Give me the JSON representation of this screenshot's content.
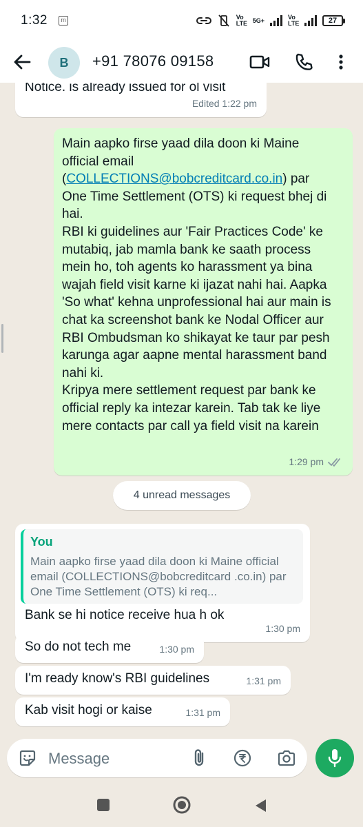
{
  "status_bar": {
    "time": "1:32",
    "net_type": "5G+",
    "volte1": "Vo LTE",
    "volte2": "Vo LTE",
    "battery": "27"
  },
  "header": {
    "avatar_letter": "B",
    "contact": "+91 78076 09158",
    "icons": [
      "back-arrow-icon",
      "video-call-icon",
      "voice-call-icon",
      "more-options-icon"
    ]
  },
  "messages": [
    {
      "id": "m0",
      "direction": "incoming",
      "text": "Notice. is already issued for ol visit",
      "time": "Edited 1:22 pm"
    },
    {
      "id": "m1",
      "direction": "outgoing",
      "text_before_link": "Main aapko firse yaad dila doon ki Maine official email (",
      "link": "COLLECTIONS@bobcreditcard.co.in",
      "text_after_link": ") par One Time Settlement (OTS) ki request bhej di hai.",
      "paragraph2": "RBI ki guidelines aur 'Fair Practices Code' ke mutabiq, jab mamla bank ke saath process mein ho, toh agents ko harassment ya bina wajah field visit karne ki ijazat nahi hai. Aapka 'So what' kehna unprofessional hai aur main is chat ka screenshot bank ke Nodal Officer aur RBI Ombudsman ko shikayat ke taur par pesh karunga agar aapne mental harassment band nahi ki.",
      "paragraph3": "Kripya mere settlement request par bank ke official reply ka intezar karein. Tab tak ke liye mere contacts par call ya field visit na karein",
      "time": "1:29 pm",
      "status": "read"
    }
  ],
  "unread_label": "4 unread messages",
  "reply_message": {
    "quote_author": "You",
    "quote_text": "Main aapko firse yaad dila doon ki Maine official email (COLLECTIONS@bobcreditcard .co.in) par One Time Settlement (OTS) ki req...",
    "text": "Bank se hi notice receive hua h ok",
    "time": "1:30 pm"
  },
  "incoming_messages": [
    {
      "text": "So do not tech me",
      "time": "1:30 pm"
    },
    {
      "text": "I'm ready know's RBI guidelines",
      "time": "1:31 pm"
    },
    {
      "text": "Kab visit hogi or kaise",
      "time": "1:31 pm"
    }
  ],
  "composer": {
    "placeholder": "Message",
    "icons": [
      "sticker-icon",
      "attach-icon",
      "rupee-payment-icon",
      "camera-icon",
      "mic-icon"
    ]
  },
  "colors": {
    "background": "#efeae2",
    "outgoing_bubble": "#d9fdd3",
    "incoming_bubble": "#ffffff",
    "accent": "#1daa61",
    "read_ticks": "#53bdeb",
    "link": "#027eb5"
  }
}
